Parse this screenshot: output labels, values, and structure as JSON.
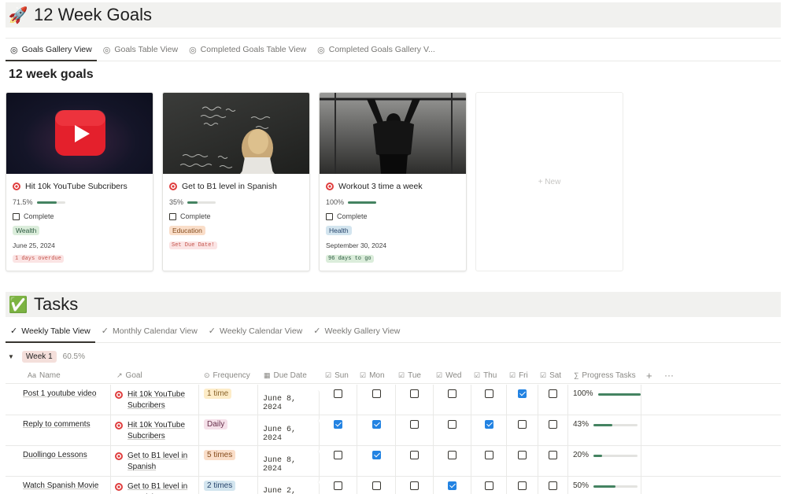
{
  "page": {
    "title": "12 Week Goals",
    "title_emoji": "🚀",
    "gallery_tabs": [
      {
        "label": "Goals Gallery View",
        "active": true
      },
      {
        "label": "Goals Table View",
        "active": false
      },
      {
        "label": "Completed Goals Table View",
        "active": false
      },
      {
        "label": "Completed Goals Gallery V...",
        "active": false
      }
    ],
    "gallery_heading": "12 week goals"
  },
  "goals": [
    {
      "title": "Hit 10k YouTube Subcribers",
      "progress": "71.5%",
      "progress_value": 0.715,
      "complete_label": "Complete",
      "tag": "Wealth",
      "tag_bg": "#dbeddb",
      "tag_fg": "#2b593f",
      "date": "June 25, 2024",
      "due": "1 days overdue",
      "due_bg": "#fbe4e4",
      "due_fg": "#c4554d"
    },
    {
      "title": "Get to B1 level in Spanish",
      "progress": "35%",
      "progress_value": 0.35,
      "complete_label": "Complete",
      "tag": "Education",
      "tag_bg": "#fadec9",
      "tag_fg": "#854c1d",
      "date": "",
      "due": "Set Due Date!",
      "due_bg": "#fbe4e4",
      "due_fg": "#c4554d"
    },
    {
      "title": "Workout 3 time a week",
      "progress": "100%",
      "progress_value": 1.0,
      "complete_label": "Complete",
      "tag": "Health",
      "tag_bg": "#d3e5ef",
      "tag_fg": "#28456c",
      "date": "September 30, 2024",
      "due": "96 days to go",
      "due_bg": "#dbeddb",
      "due_fg": "#2b593f"
    }
  ],
  "new_label": "+ New",
  "tasks": {
    "title": "Tasks",
    "title_emoji": "✅",
    "tabs": [
      {
        "label": "Weekly Table View",
        "active": true
      },
      {
        "label": "Monthly Calendar View",
        "active": false
      },
      {
        "label": "Weekly Calendar View",
        "active": false
      },
      {
        "label": "Weekly Gallery View",
        "active": false
      }
    ],
    "group": {
      "label": "Week 1",
      "percent": "60.5%"
    },
    "columns": {
      "name": "Name",
      "goal": "Goal",
      "frequency": "Frequency",
      "due": "Due Date",
      "sun": "Sun",
      "mon": "Mon",
      "tue": "Tue",
      "wed": "Wed",
      "thu": "Thu",
      "fri": "Fri",
      "sat": "Sat",
      "progress": "Progress Tasks"
    },
    "rows": [
      {
        "name": "Post 1 youtube video",
        "goal": "Hit 10k YouTube Subcribers",
        "frequency": "1 time",
        "freq_bg": "#fdecc8",
        "freq_fg": "#89632a",
        "due": "June 8, 2024",
        "days": [
          false,
          false,
          false,
          false,
          false,
          true,
          false
        ],
        "progress": "100%",
        "progress_value": 1.0
      },
      {
        "name": "Reply to comments",
        "goal": "Hit 10k YouTube Subcribers",
        "frequency": "Daily",
        "freq_bg": "#f5e0e9",
        "freq_fg": "#69314c",
        "due": "June 6, 2024",
        "days": [
          true,
          true,
          false,
          false,
          true,
          false,
          false
        ],
        "progress": "43%",
        "progress_value": 0.43
      },
      {
        "name": "Duollingo Lessons",
        "goal": "Get to B1 level in Spanish",
        "frequency": "5 times",
        "freq_bg": "#fadec9",
        "freq_fg": "#854c1d",
        "due": "June 8, 2024",
        "days": [
          false,
          true,
          false,
          false,
          false,
          false,
          false
        ],
        "progress": "20%",
        "progress_value": 0.2
      },
      {
        "name": "Watch Spanish Movie",
        "goal": "Get to B1 level in Spanish",
        "frequency": "2 times",
        "freq_bg": "#d3e5ef",
        "freq_fg": "#28456c",
        "due": "June 2, 2024",
        "days": [
          false,
          false,
          false,
          true,
          false,
          false,
          false
        ],
        "progress": "50%",
        "progress_value": 0.5
      }
    ]
  }
}
